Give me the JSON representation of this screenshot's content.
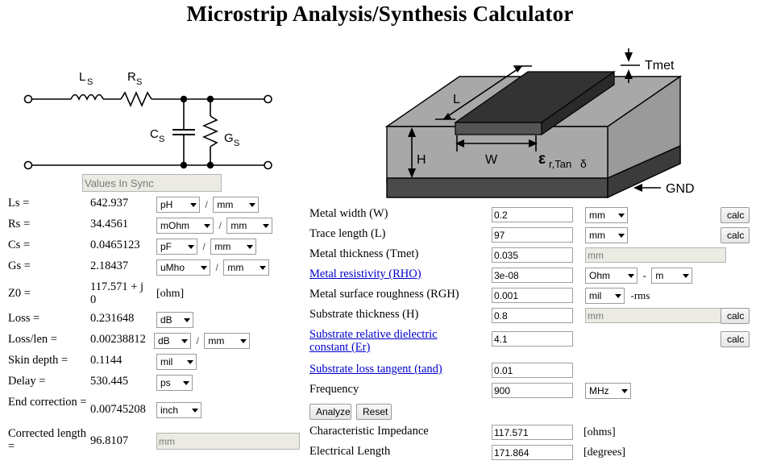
{
  "title": "Microstrip Analysis/Synthesis Calculator",
  "schematic": {
    "name": "lumped-element-equivalent-circuit",
    "labels": [
      {
        "base": "L",
        "sub": "S"
      },
      {
        "base": "R",
        "sub": "S"
      },
      {
        "base": "C",
        "sub": "S"
      },
      {
        "base": "G",
        "sub": "S"
      }
    ]
  },
  "microstrip": {
    "name": "microstrip-cross-section-diagram",
    "labels": {
      "length": "L",
      "width": "W",
      "height": "H",
      "metal_thickness": "Tmet",
      "ground": "GND",
      "epsilon": "ε",
      "epsilon_sub": "r,Tan",
      "delta": "δ"
    }
  },
  "left": {
    "sync_status": "Values In Sync",
    "rows": [
      {
        "label": "Ls =",
        "value": "642.937",
        "unit": "pH",
        "per": "mm",
        "has_per": true,
        "type": "select"
      },
      {
        "label": "Rs =",
        "value": "34.4561",
        "unit": "mOhm",
        "per": "mm",
        "has_per": true,
        "type": "select"
      },
      {
        "label": "Cs =",
        "value": "0.0465123",
        "unit": "pF",
        "per": "mm",
        "has_per": true,
        "type": "select"
      },
      {
        "label": "Gs =",
        "value": "2.18437",
        "unit": "uMho",
        "per": "mm",
        "has_per": true,
        "type": "select"
      },
      {
        "label": "Z0 =",
        "value": "117.571 + j 0",
        "unit": "[ohm]",
        "per": "",
        "has_per": false,
        "type": "text"
      },
      {
        "label": "Loss =",
        "value": "0.231648",
        "unit": "dB",
        "per": "",
        "has_per": false,
        "type": "select"
      },
      {
        "label": "Loss/len =",
        "value": "0.00238812",
        "unit": "dB",
        "per": "mm",
        "has_per": true,
        "type": "select"
      },
      {
        "label": "Skin depth =",
        "value": "0.1144",
        "unit": "mil",
        "per": "",
        "has_per": false,
        "type": "select"
      },
      {
        "label": "Delay =",
        "value": "530.445",
        "unit": "ps",
        "per": "",
        "has_per": false,
        "type": "select"
      },
      {
        "label": "End correction =",
        "value": "0.00745208",
        "unit": "inch",
        "per": "",
        "has_per": false,
        "type": "select"
      },
      {
        "label": "Corrected length =",
        "value": "96.8107",
        "unit": "mm",
        "per": "",
        "has_per": false,
        "type": "readonly"
      }
    ]
  },
  "right": {
    "rows": [
      {
        "label": "Metal width (W)",
        "is_link": false,
        "value": "0.2",
        "unit": "mm",
        "unit_kind": "select",
        "unit2": "",
        "suffix": "",
        "calc": "calc"
      },
      {
        "label": "Trace length (L)",
        "is_link": false,
        "value": "97",
        "unit": "mm",
        "unit_kind": "select",
        "unit2": "",
        "suffix": "",
        "calc": "calc"
      },
      {
        "label": "Metal thickness (Tmet)",
        "is_link": false,
        "value": "0.035",
        "unit": "mm",
        "unit_kind": "readonly",
        "unit2": "",
        "suffix": "",
        "calc": ""
      },
      {
        "label": "Metal resistivity (RHO)",
        "is_link": true,
        "value": "3e-08",
        "unit": "Ohm",
        "unit_kind": "select2",
        "unit2": "m",
        "suffix": "",
        "calc": ""
      },
      {
        "label": "Metal surface roughness (RGH)",
        "is_link": false,
        "value": "0.001",
        "unit": "mil",
        "unit_kind": "select",
        "unit2": "",
        "suffix": "-rms",
        "calc": ""
      },
      {
        "label": "Substrate thickness (H)",
        "is_link": false,
        "value": "0.8",
        "unit": "mm",
        "unit_kind": "readonly",
        "unit2": "",
        "suffix": "",
        "calc": "calc"
      },
      {
        "label": "Substrate relative dielectric constant (Er)",
        "is_link": true,
        "value": "4.1",
        "unit": "",
        "unit_kind": "none",
        "unit2": "",
        "suffix": "",
        "calc": "calc"
      },
      {
        "label": "Substrate loss tangent (tand)",
        "is_link": true,
        "value": "0.01",
        "unit": "",
        "unit_kind": "none",
        "unit2": "",
        "suffix": "",
        "calc": ""
      },
      {
        "label": "Frequency",
        "is_link": false,
        "value": "900",
        "unit": "MHz",
        "unit_kind": "select",
        "unit2": "",
        "suffix": "",
        "calc": ""
      }
    ],
    "analyze_label": "Analyze",
    "reset_label": "Reset",
    "results": [
      {
        "label": "Characteristic Impedance",
        "value": "117.571",
        "unit": "[ohms]"
      },
      {
        "label": "Electrical Length",
        "value": "171.864",
        "unit": "[degrees]"
      }
    ]
  },
  "colors": {
    "link": "#0000cc",
    "readonly_bg": "#ebebe4",
    "substrate_light": "#a8a8a8",
    "substrate_mid": "#9a9a9a",
    "metal_dark": "#3b3b3b",
    "metal_mid": "#565656",
    "ground": "#4a4a4a"
  }
}
